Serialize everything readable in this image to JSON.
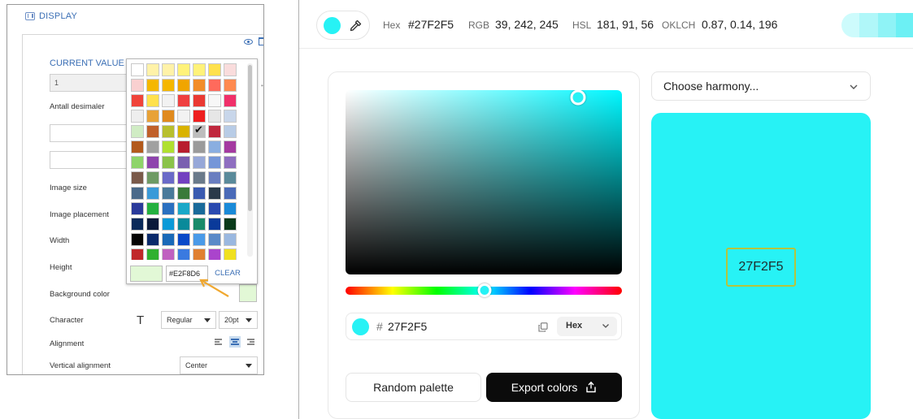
{
  "left_panel": {
    "section_title": "DISPLAY",
    "current_value_label": "CURRENT VALUE",
    "current_value": "1",
    "decimals_label": "Antall desimaler",
    "image_size_label": "Image size",
    "image_placement_label": "Image placement",
    "width_label": "Width",
    "height_label": "Height",
    "background_color_label": "Background color",
    "background_color": "#E2F8D6",
    "character_label": "Character",
    "font_style": "Regular",
    "font_size": "20pt",
    "alignment_label": "Alignment",
    "vertical_alignment_label": "Vertical alignment",
    "vertical_alignment": "Center",
    "character_icon": "T",
    "icons": [
      "display-icon",
      "eye-icon",
      "trash-icon",
      "font-t-icon",
      "align-left-icon",
      "align-center-icon",
      "align-right-icon"
    ]
  },
  "color_picker_popup": {
    "hex_value": "#E2F8D6",
    "clear_label": "CLEAR",
    "selected_swatch": "row4-col4",
    "swatch_rows": [
      [
        "#ffffff",
        "#fff2a8",
        "#fff2a8",
        "#fff27a",
        "#fff27a",
        "#ffe14d",
        "#f9dcdc"
      ],
      [
        "#f9d0d0",
        "#f5b700",
        "#f5b700",
        "#f0a500",
        "#f28c28",
        "#ff6a5c",
        "#ff8a50"
      ],
      [
        "#f0443a",
        "#ffe14d",
        "#f2f2f2",
        "#ef4040",
        "#ea3a33",
        "#f7f7f7",
        "#f0306a"
      ],
      [
        "#eeeeee",
        "#e8a237",
        "#e08a1e",
        "#f2f2f2",
        "#ee1f1f",
        "#e6e6e6",
        "#c8d6ea"
      ],
      [
        "#d0ecc4",
        "#c0602a",
        "#b8bf2e",
        "#d9b300",
        "#bdbdbd",
        "#c0283e",
        "#b8cce6"
      ],
      [
        "#b35a1c",
        "#a0a0a0",
        "#b0e030",
        "#b81e2e",
        "#9a9a9a",
        "#8aaee0",
        "#a43aa0"
      ],
      [
        "#8ed46a",
        "#8e44ad",
        "#8bc34a",
        "#7a5fb0",
        "#97a8d8",
        "#7596d8",
        "#8e6ec0"
      ],
      [
        "#7a5a4a",
        "#6e9a64",
        "#6a6ac8",
        "#7340c0",
        "#6a7a8a",
        "#6a7ec0",
        "#5a8a9a"
      ],
      [
        "#4a6a8a",
        "#3a9ad8",
        "#4a7a9a",
        "#3a7a3a",
        "#3a5ab0",
        "#2a3a4a",
        "#4a6ab8"
      ],
      [
        "#2a3a9a",
        "#24b040",
        "#2a70c0",
        "#1aa8c8",
        "#1a6a9a",
        "#2a4ab0",
        "#1a8ad8"
      ],
      [
        "#0a2a5a",
        "#0a1a3a",
        "#0a9ad8",
        "#0a8a9a",
        "#1a8a6a",
        "#0a3a9a",
        "#0a3a1a"
      ],
      [
        "#050505",
        "#0a2a6a",
        "#1a6ab8",
        "#0a4ac8",
        "#4a9ae8",
        "#5a8ac8",
        "#9ab8e0"
      ],
      [
        "#c0282a",
        "#30b030",
        "#c060c0",
        "#3a7ae0",
        "#e08030",
        "#aa44cc",
        "#f0e020"
      ]
    ]
  },
  "top_bar": {
    "current_color": "#27F2F5",
    "hex_label": "Hex",
    "hex_value": "#27F2F5",
    "rgb_label": "RGB",
    "rgb_value": "39, 242, 245",
    "hsl_label": "HSL",
    "hsl_value": "181, 91, 56",
    "oklch_label": "OKLCH",
    "oklch_value": "0.87, 0.14, 196",
    "strip_colors": [
      "#cdfbfc",
      "#b0f7f9",
      "#8ff3f6",
      "#6cf0f4"
    ]
  },
  "picker": {
    "saturation_pct": 84,
    "value_pct": 96,
    "hue_deg": 181,
    "hex_hash": "#",
    "hex_value": "27F2F5",
    "format": "Hex",
    "random_palette_label": "Random palette",
    "export_colors_label": "Export colors"
  },
  "harmony": {
    "placeholder": "Choose harmony...",
    "swatch_color": "#27F2F5",
    "swatch_label": "27F2F5"
  }
}
